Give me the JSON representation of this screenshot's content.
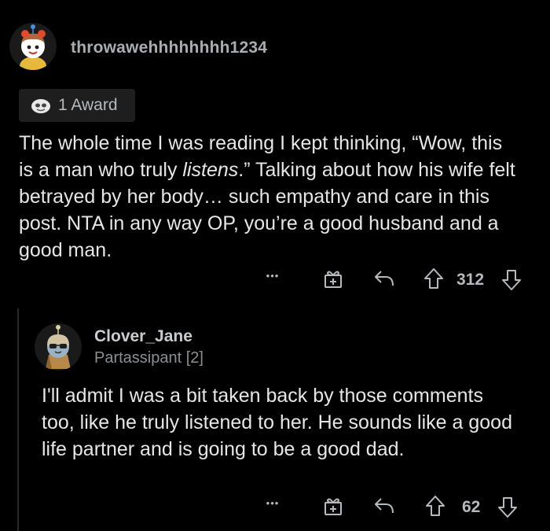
{
  "comment": {
    "username": "throwawehhhhhhhh1234",
    "award_label": "1 Award",
    "text_before": "The whole time I was reading I kept thinking, “Wow, this is a man who truly ",
    "text_italic": "listens",
    "text_after": ".” Talking about how his wife felt betrayed by her body… such empathy and care in this post. NTA in any way OP, you’re a good husband and a good man.",
    "more_label": "•••",
    "votes": "312"
  },
  "reply": {
    "username": "Clover_Jane",
    "flair": "Partassipant [2]",
    "text": "I'll admit I was a bit taken back by those comments too, like he truly listened to her. He sounds like a good life partner and is going to be a good dad.",
    "more_label": "•••",
    "votes": "62"
  },
  "icons": {
    "gift": "gift-icon",
    "reply": "reply-arrow-icon",
    "upvote": "upvote-arrow-icon",
    "downvote": "downvote-arrow-icon",
    "award": "award-icon"
  },
  "colors": {
    "background": "#000000",
    "text": "#e6e6e6",
    "muted": "#b6babd"
  }
}
